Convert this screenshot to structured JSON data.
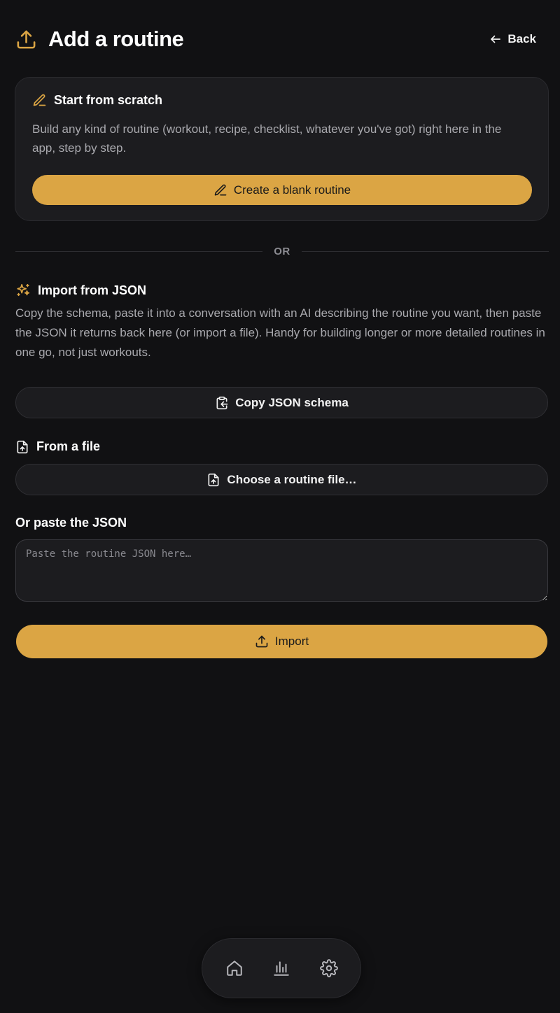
{
  "header": {
    "title": "Add a routine",
    "back_label": "Back",
    "title_icon": "upload-icon",
    "accent_color": "#dba544"
  },
  "scratch": {
    "heading": "Start from scratch",
    "description": "Build any kind of routine (workout, recipe, checklist, whatever you've got) right here in the app, step by step.",
    "button_label": "Create a blank routine",
    "icon": "pencil-icon"
  },
  "divider": {
    "label": "OR"
  },
  "import": {
    "heading": "Import from JSON",
    "description": "Copy the schema, paste it into a conversation with an AI describing the routine you want, then paste the JSON it returns back here (or import a file). Handy for building longer or more detailed routines in one go, not just workouts.",
    "copy_schema_label": "Copy JSON schema",
    "from_file_label": "From a file",
    "choose_file_label": "Choose a routine file…",
    "paste_label": "Or paste the JSON",
    "textarea_placeholder": "Paste the routine JSON here…",
    "import_button_label": "Import"
  },
  "nav": {
    "items": [
      "home-icon",
      "bar-chart-icon",
      "gear-icon"
    ]
  }
}
